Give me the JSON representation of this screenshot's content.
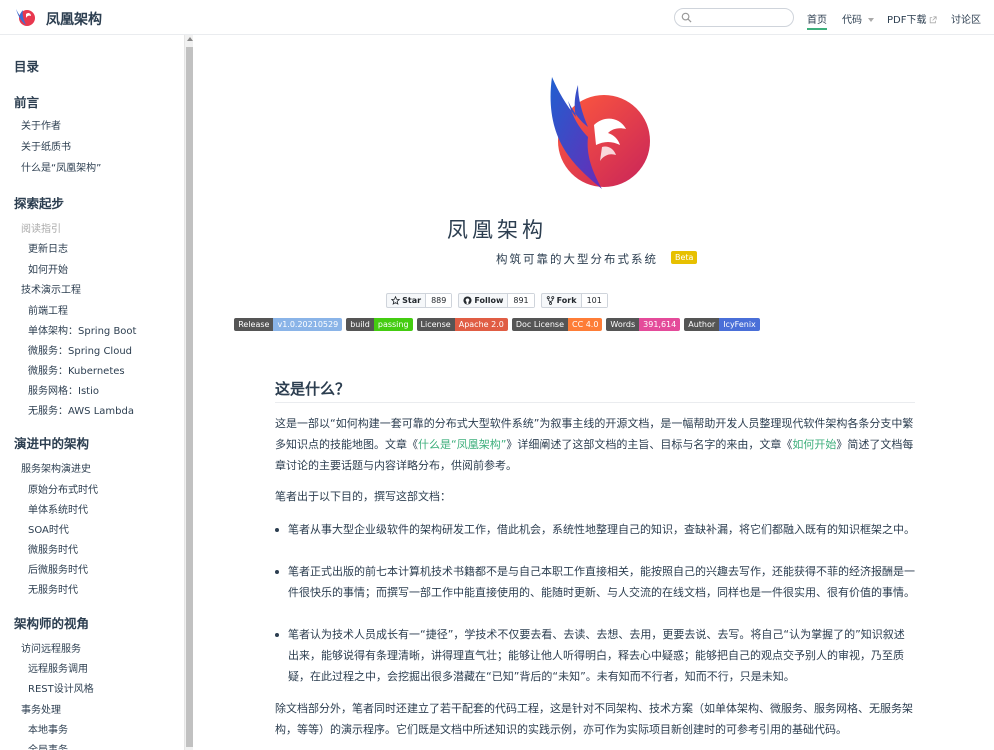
{
  "nav": {
    "site_name": "凤凰架构",
    "search_placeholder": "",
    "links": [
      {
        "label": "首页",
        "active": true
      },
      {
        "label": "代码",
        "dropdown": true
      },
      {
        "label": "PDF下载",
        "external": true
      },
      {
        "label": "讨论区"
      }
    ]
  },
  "sidebar": {
    "toc": "目录",
    "sections": [
      {
        "title": "前言",
        "items": [
          "关于作者",
          "关于纸质书",
          "什么是“凤凰架构”"
        ]
      },
      {
        "title": "探索起步",
        "items": [
          "阅读指引",
          "更新日志",
          "如何开始",
          "技术演示工程",
          "前端工程",
          "单体架构：Spring Boot",
          "微服务：Spring Cloud",
          "微服务：Kubernetes",
          "服务网格：Istio",
          "无服务：AWS Lambda"
        ]
      },
      {
        "title": "演进中的架构",
        "items": [
          "服务架构演进史",
          "原始分布式时代",
          "单体系统时代",
          "SOA时代",
          "微服务时代",
          "后微服务时代",
          "无服务时代"
        ]
      },
      {
        "title": "架构师的视角",
        "items": [
          "访问远程服务",
          "远程服务调用",
          "REST设计风格",
          "事务处理",
          "本地事务",
          "全局事务"
        ]
      }
    ]
  },
  "hero": {
    "title": "凤凰架构",
    "subtitle": "构筑可靠的大型分布式系统",
    "beta": "Beta"
  },
  "github": [
    {
      "label": "Star",
      "count": "889",
      "icon": "star-icon"
    },
    {
      "label": "Follow",
      "count": "891",
      "icon": "github-icon"
    },
    {
      "label": "Fork",
      "count": "101",
      "icon": "fork-icon"
    }
  ],
  "badges": [
    {
      "left": "Release",
      "right": "v1.0.20210529",
      "color": "#8ab4e8"
    },
    {
      "left": "build",
      "right": "passing",
      "color": "#4c1"
    },
    {
      "left": "License",
      "right": "Apache 2.0",
      "color": "#e05d44"
    },
    {
      "left": "Doc License",
      "right": "CC 4.0",
      "color": "#fe7d37"
    },
    {
      "left": "Words",
      "right": "391,614",
      "color": "#e44b9a"
    },
    {
      "left": "Author",
      "right": "IcyFenix",
      "color": "#4a6fd8"
    }
  ],
  "content": {
    "heading": "这是什么？",
    "intro_1": "这是一部以“如何构建一套可靠的分布式大型软件系统”为叙事主线的开源文档，是一幅帮助开发人员整理现代软件架构各条分支中繁多知识点的技能地图。文章《",
    "intro_link_1": "什么是“凤凰架构”",
    "intro_2": "》详细阐述了这部文档的主旨、目标与名字的来由，文章《",
    "intro_link_2": "如何开始",
    "intro_3": "》简述了文档每章讨论的主要话题与内容详略分布，供阅前参考。",
    "purpose": "笔者出于以下目的，撰写这部文档：",
    "bullets": [
      "笔者从事大型企业级软件的架构研发工作，借此机会，系统性地整理自己的知识，查缺补漏，将它们都融入既有的知识框架之中。",
      "笔者正式出版的前七本计算机技术书籍都不是与自己本职工作直接相关，能按照自己的兴趣去写作，还能获得不菲的经济报酬是一件很快乐的事情；而撰写一部工作中能直接使用的、能随时更新、与人交流的在线文档，同样也是一件很实用、很有价值的事情。",
      "笔者认为技术人员成长有一“捷径”，学技术不仅要去看、去读、去想、去用，更要去说、去写。将自己“认为掌握了的”知识叙述出来，能够说得有条理清晰，讲得理直气壮；能够让他人听得明白，释去心中疑惑；能够把自己的观点交予别人的审视，乃至质疑，在此过程之中，会挖掘出很多潜藏在“已知”背后的“未知”。未有知而不行者，知而不行，只是未知。"
    ],
    "closing": "除文档部分外，笔者同时还建立了若干配套的代码工程，这是针对不同架构、技术方案（如单体架构、微服务、服务网格、无服务架构，等等）的演示程序。它们既是文档中所述知识的实践示例，亦可作为实际项目新创建时的可参考引用的基础代码。"
  },
  "colors": {
    "accent": "#3eaf7c",
    "text": "#2c3e50",
    "beta": "#e7c000"
  }
}
